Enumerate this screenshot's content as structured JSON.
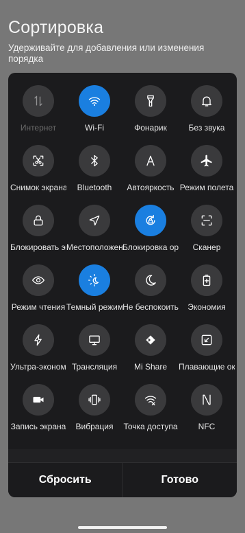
{
  "header": {
    "title": "Сортировка",
    "subtitle": "Удерживайте для добавления или изменения порядка"
  },
  "colors": {
    "background": "#777777",
    "panel": "#1b1b1d",
    "tile": "#3a3a3c",
    "accent": "#1a7fe0"
  },
  "tiles": [
    {
      "label": "Интернет",
      "icon": "mobile-data-icon",
      "active": false,
      "disabled": true
    },
    {
      "label": "Wi-Fi",
      "icon": "wifi-icon",
      "active": true,
      "disabled": false
    },
    {
      "label": "Фонарик",
      "icon": "flashlight-icon",
      "active": false,
      "disabled": false
    },
    {
      "label": "Без звука",
      "icon": "bell-icon",
      "active": false,
      "disabled": false
    },
    {
      "label": "Снимок экрана",
      "icon": "screenshot-icon",
      "active": false,
      "disabled": false
    },
    {
      "label": "Bluetooth",
      "icon": "bluetooth-icon",
      "active": false,
      "disabled": false
    },
    {
      "label": "Автояркость",
      "icon": "auto-brightness-icon",
      "active": false,
      "disabled": false
    },
    {
      "label": "Режим полета",
      "icon": "airplane-icon",
      "active": false,
      "disabled": false
    },
    {
      "label": "Блокировать экран",
      "icon": "lock-icon",
      "active": false,
      "disabled": false
    },
    {
      "label": "Местоположение",
      "icon": "location-icon",
      "active": false,
      "disabled": false
    },
    {
      "label": "Блокировка ориентации",
      "icon": "rotation-lock-icon",
      "active": true,
      "disabled": false
    },
    {
      "label": "Сканер",
      "icon": "scanner-icon",
      "active": false,
      "disabled": false
    },
    {
      "label": "Режим чтения",
      "icon": "eye-icon",
      "active": false,
      "disabled": false
    },
    {
      "label": "Темный режим",
      "icon": "dark-mode-icon",
      "active": true,
      "disabled": false
    },
    {
      "label": "Не беспокоить",
      "icon": "moon-icon",
      "active": false,
      "disabled": false
    },
    {
      "label": "Экономия",
      "icon": "battery-saver-icon",
      "active": false,
      "disabled": false
    },
    {
      "label": "Ультра-экономия",
      "icon": "lightning-icon",
      "active": false,
      "disabled": false
    },
    {
      "label": "Трансляция",
      "icon": "cast-icon",
      "active": false,
      "disabled": false
    },
    {
      "label": "Mi Share",
      "icon": "mi-share-icon",
      "active": false,
      "disabled": false
    },
    {
      "label": "Плавающие окна",
      "icon": "floating-window-icon",
      "active": false,
      "disabled": false
    },
    {
      "label": "Запись экрана",
      "icon": "screen-record-icon",
      "active": false,
      "disabled": false
    },
    {
      "label": "Вибрация",
      "icon": "vibration-icon",
      "active": false,
      "disabled": false
    },
    {
      "label": "Точка доступа",
      "icon": "hotspot-icon",
      "active": false,
      "disabled": false
    },
    {
      "label": "NFC",
      "icon": "nfc-icon",
      "active": false,
      "disabled": false
    }
  ],
  "actions": {
    "reset_label": "Сбросить",
    "done_label": "Готово"
  }
}
